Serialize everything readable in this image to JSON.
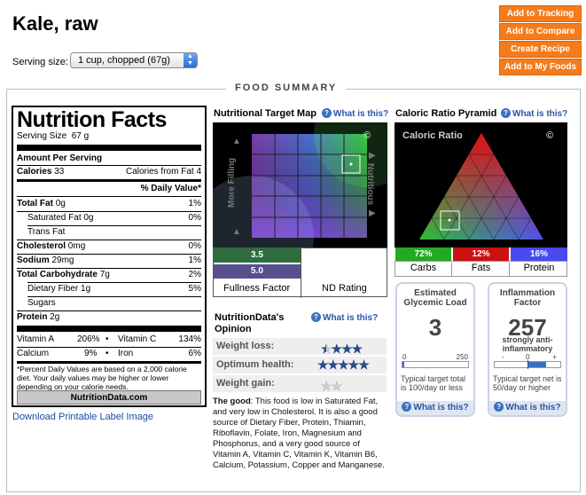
{
  "header": {
    "title": "Kale, raw",
    "serving_label": "Serving size:",
    "serving_value": "1 cup, chopped (67g)"
  },
  "buttons": {
    "tracking": "Add to Tracking",
    "compare": "Add to Compare",
    "recipe": "Create Recipe",
    "my_foods": "Add to My Foods"
  },
  "summary_title": "FOOD SUMMARY",
  "nutrition_facts": {
    "heading": "Nutrition Facts",
    "serving_size_label": "Serving Size",
    "serving_size_value": "67 g",
    "amount_per_serving": "Amount Per Serving",
    "calories_label": "Calories",
    "calories_value": "33",
    "calories_fat_label": "Calories from Fat",
    "calories_fat_value": "4",
    "dv_header": "% Daily Value*",
    "rows": [
      {
        "label": "Total Fat",
        "amount": "0g",
        "dv": "1%"
      },
      {
        "label": "Saturated Fat",
        "amount": "0g",
        "dv": "0%"
      },
      {
        "label": "Trans Fat",
        "amount": "",
        "dv": ""
      },
      {
        "label": "Cholesterol",
        "amount": "0mg",
        "dv": "0%"
      },
      {
        "label": "Sodium",
        "amount": "29mg",
        "dv": "1%"
      },
      {
        "label": "Total Carbohydrate",
        "amount": "7g",
        "dv": "2%"
      },
      {
        "label": "Dietary Fiber",
        "amount": "1g",
        "dv": "5%"
      },
      {
        "label": "Sugars",
        "amount": "",
        "dv": ""
      },
      {
        "label": "Protein",
        "amount": "2g",
        "dv": ""
      }
    ],
    "vitamins": [
      {
        "a_label": "Vitamin A",
        "a_value": "206%",
        "b_label": "Vitamin C",
        "b_value": "134%"
      },
      {
        "a_label": "Calcium",
        "a_value": "9%",
        "b_label": "Iron",
        "b_value": "6%"
      }
    ],
    "footnote": "*Percent Daily Values are based on a 2,000 calorie diet. Your daily values may be higher or lower depending on your calorie needs.",
    "logo": "NutritionData.com"
  },
  "download_link": "Download Printable Label Image",
  "target_map": {
    "title": "Nutritional Target Map",
    "what": "What is this?",
    "side_left": "More Filling",
    "side_right": "Nutritious",
    "copyright": "©",
    "fullness_value": "3.5",
    "nd_value": "5.0",
    "fullness_label": "Fullness Factor",
    "nd_label": "ND Rating"
  },
  "opinion": {
    "title": "NutritionData's Opinion",
    "what": "What is this?",
    "items": [
      {
        "label": "Weight loss:",
        "stars": "★★★★★",
        "rating": 4.5
      },
      {
        "label": "Optimum health:",
        "stars": "★★★★★",
        "rating": 5
      },
      {
        "label": "Weight gain:",
        "stars": "★★★★★",
        "rating": 2.5
      }
    ],
    "good_label": "The good",
    "good_text": ": This food is low in Saturated Fat, and very low in Cholesterol. It is also a good source of Dietary Fiber, Protein, Thiamin, Riboflavin, Folate, Iron, Magnesium and Phosphorus, and a very good source of Vitamin A, Vitamin C, Vitamin K, Vitamin B6, Calcium, Potassium, Copper and Manganese."
  },
  "pyramid": {
    "title": "Caloric Ratio Pyramid",
    "what": "What is this?",
    "label": "Caloric Ratio",
    "copyright": "©",
    "carbs_pct": "72%",
    "fats_pct": "12%",
    "protein_pct": "16%",
    "carbs_label": "Carbs",
    "fats_label": "Fats",
    "protein_label": "Protein",
    "colors": {
      "carbs": "#22aa22",
      "fats": "#cc1111",
      "protein": "#4a4aee"
    }
  },
  "glycemic": {
    "title": "Estimated Glycemic Load",
    "value": "3",
    "scale_min": "0",
    "scale_max": "250",
    "note": "Typical target total is 100/day or less",
    "what": "What is this?"
  },
  "inflammation": {
    "title": "Inflammation Factor",
    "value": "257",
    "desc": "strongly anti-inflammatory",
    "scale_minus": "-",
    "scale_zero": "0",
    "scale_plus": "+",
    "note": "Typical target net is 50/day or higher",
    "what": "What is this?"
  }
}
